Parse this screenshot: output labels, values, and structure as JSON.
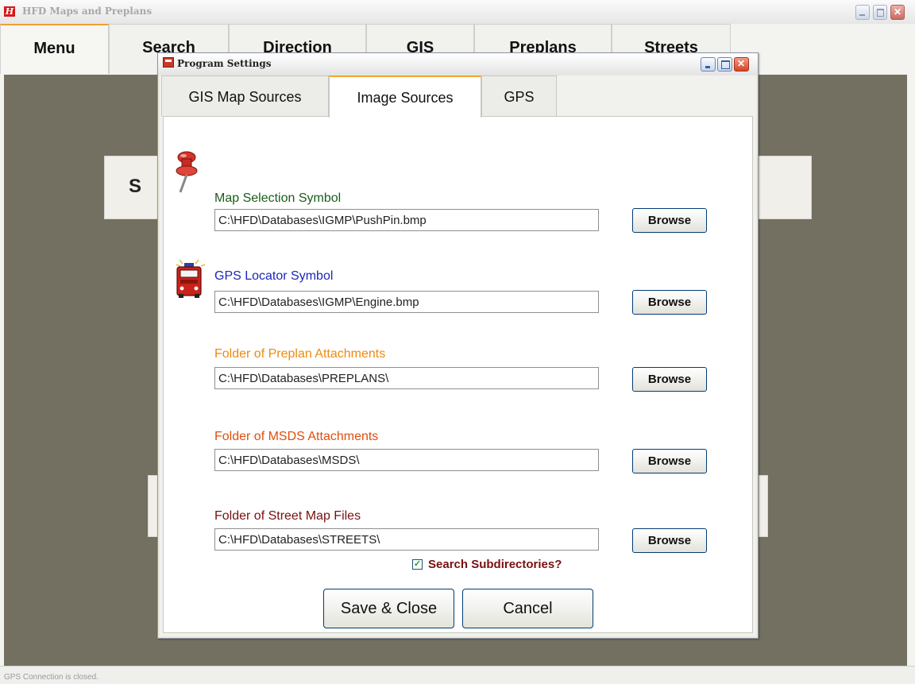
{
  "app": {
    "title": "HFD Maps and Preplans",
    "icon_letter": "H",
    "main_tabs": [
      "Menu",
      "Search",
      "Direction",
      "GIS",
      "Preplans",
      "Streets"
    ],
    "bg_card_letter": "S",
    "status": "GPS Connection is closed."
  },
  "dialog": {
    "title": "Program Settings",
    "tabs": [
      "GIS Map Sources",
      "Image Sources",
      "GPS"
    ],
    "active_tab": "Image Sources",
    "fields": [
      {
        "label": "Map Selection Symbol",
        "value": "C:\\HFD\\Databases\\IGMP\\PushPin.bmp",
        "color": "#1a5c1a",
        "icon": "push-pin-icon"
      },
      {
        "label": "GPS Locator Symbol",
        "value": "C:\\HFD\\Databases\\IGMP\\Engine.bmp",
        "color": "#1c27b8",
        "icon": "fire-engine-icon"
      },
      {
        "label": "Folder of Preplan Attachments",
        "value": "C:\\HFD\\Databases\\PREPLANS\\",
        "color": "#ee8a10"
      },
      {
        "label": "Folder of MSDS Attachments",
        "value": "C:\\HFD\\Databases\\MSDS\\",
        "color": "#e04e0e"
      },
      {
        "label": "Folder of Street Map Files",
        "value": "C:\\HFD\\Databases\\STREETS\\",
        "color": "#7a1010"
      }
    ],
    "browse_label": "Browse",
    "search_subdirectories": {
      "label": "Search Subdirectories?",
      "checked": true,
      "color": "#7a1010"
    },
    "save_label": "Save & Close",
    "cancel_label": "Cancel"
  }
}
